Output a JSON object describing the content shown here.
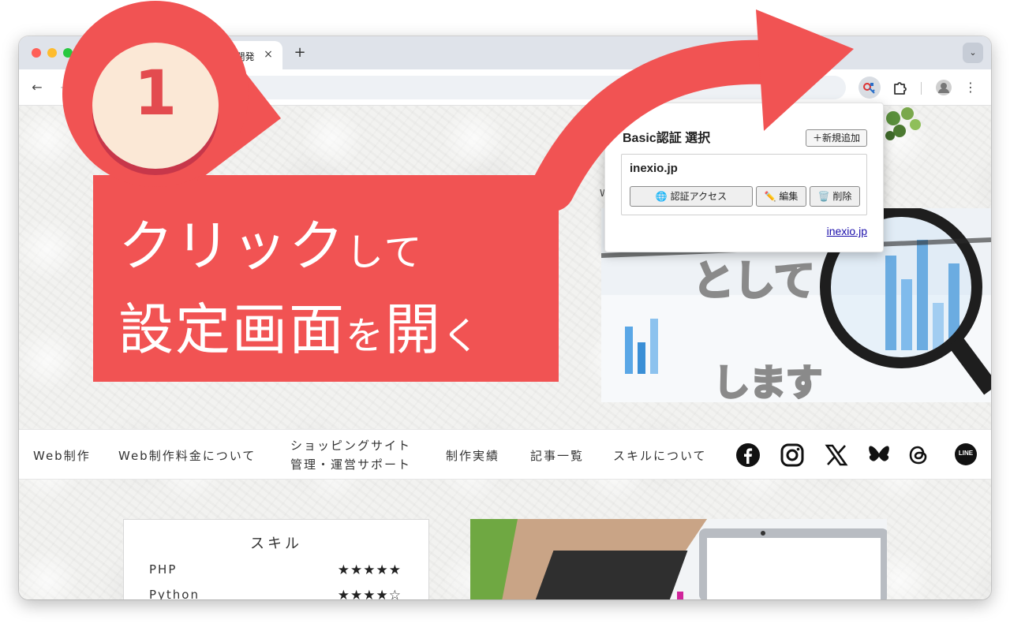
{
  "browser": {
    "tab_title": "Web開発",
    "tab_close": "×",
    "new_tab": "+",
    "tab_menu": "⌄",
    "back": "←",
    "forward": "→",
    "menu": "⋮"
  },
  "site": {
    "nav": [
      {
        "label": "Web制作"
      },
      {
        "label": "Web制作料金について"
      },
      {
        "line1": "ショッピングサイト",
        "line2": "管理・運営サポート"
      },
      {
        "label": "制作実績"
      },
      {
        "label": "記事一覧"
      },
      {
        "label": "スキルについて"
      }
    ],
    "social_icons": [
      "facebook-icon",
      "instagram-icon",
      "x-icon",
      "bluesky-icon",
      "threads-icon",
      "line-icon"
    ],
    "line_label": "LINE",
    "hero": {
      "top_text": "W",
      "word1": "として",
      "word3": "します"
    },
    "skills": {
      "title": "スキル",
      "items": [
        {
          "name": "PHP",
          "stars": "★★★★★"
        },
        {
          "name": "Python",
          "stars": "★★★★☆"
        }
      ]
    }
  },
  "popup": {
    "title": "Basic認証 選択",
    "add_button": "＋新規追加",
    "entries": [
      {
        "name": "inexio.jp",
        "access_label": "🌐 認証アクセス",
        "edit_label": "✏️ 編集",
        "delete_label": "🗑️ 削除"
      }
    ],
    "footer_link": "inexio.jp"
  },
  "callout": {
    "step_number": "1",
    "line1_large": "クリック",
    "line1_small": "して",
    "line2_large_a": "設定画面",
    "line2_small_a": "を",
    "line2_large_b": "開",
    "line2_small_b": "く"
  },
  "colors": {
    "callout_red": "#f15353",
    "callout_badge_bg": "#fbe8d6",
    "brand_teal": "#155a7a"
  }
}
